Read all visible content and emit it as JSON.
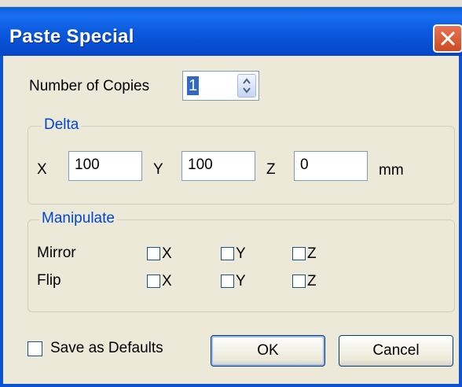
{
  "window": {
    "title": "Paste Special",
    "close_icon": "close-icon"
  },
  "copies": {
    "label": "Number of Copies",
    "value": "1"
  },
  "delta": {
    "legend": "Delta",
    "x_label": "X",
    "x_value": "100",
    "y_label": "Y",
    "y_value": "100",
    "z_label": "Z",
    "z_value": "0",
    "unit": "mm"
  },
  "manipulate": {
    "legend": "Manipulate",
    "mirror": {
      "label": "Mirror",
      "x": "X",
      "y": "Y",
      "z": "Z",
      "x_checked": false,
      "y_checked": false,
      "z_checked": false
    },
    "flip": {
      "label": "Flip",
      "x": "X",
      "y": "Y",
      "z": "Z",
      "x_checked": false,
      "y_checked": false,
      "z_checked": false
    }
  },
  "footer": {
    "save_defaults_label": "Save as Defaults",
    "save_defaults_checked": false,
    "ok_label": "OK",
    "cancel_label": "Cancel"
  },
  "colors": {
    "title_bar": "#0a58dc",
    "group_legend": "#0046d5",
    "dialog_bg": "#ece9d8",
    "close_button": "#cf4a22"
  }
}
